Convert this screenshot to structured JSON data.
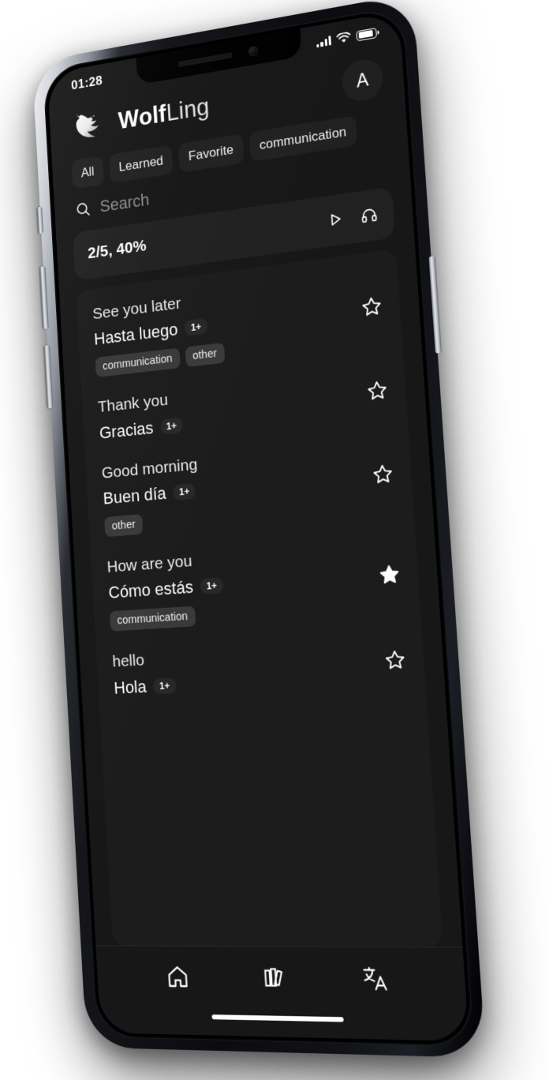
{
  "status_bar": {
    "time": "01:28",
    "cellular_icon": "cellular-bars-icon",
    "wifi_icon": "wifi-icon",
    "battery_icon": "battery-icon"
  },
  "header": {
    "logo_icon": "wolf-head-logo",
    "brand_bold": "Wolf",
    "brand_light": "Ling",
    "avatar_initial": "A"
  },
  "filters": {
    "chips": [
      {
        "label": "All"
      },
      {
        "label": "Learned"
      },
      {
        "label": "Favorite"
      },
      {
        "label": "communication"
      }
    ]
  },
  "search": {
    "icon": "search-icon",
    "placeholder": "Search",
    "value": ""
  },
  "progress": {
    "label": "2/5, 40%",
    "play_icon": "play-icon",
    "listen_icon": "headphones-icon"
  },
  "entries": [
    {
      "source": "See you later",
      "target": "Hasta luego",
      "count": "1+",
      "tags": [
        "communication",
        "other"
      ],
      "favorite": false
    },
    {
      "source": "Thank you",
      "target": "Gracias",
      "count": "1+",
      "tags": [],
      "favorite": false
    },
    {
      "source": "Good morning",
      "target": "Buen día",
      "count": "1+",
      "tags": [
        "other"
      ],
      "favorite": false
    },
    {
      "source": "How are you",
      "target": "Cómo estás",
      "count": "1+",
      "tags": [
        "communication"
      ],
      "favorite": true
    },
    {
      "source": "hello",
      "target": "Hola",
      "count": "1+",
      "tags": [],
      "favorite": false
    }
  ],
  "bottom_nav": [
    {
      "icon": "home-icon",
      "name": "home"
    },
    {
      "icon": "books-icon",
      "name": "library"
    },
    {
      "icon": "translate-icon",
      "name": "translate"
    }
  ],
  "colors": {
    "screen_bg": "#171717",
    "card_bg": "#1c1c1c",
    "chip_bg": "#212121",
    "tag_bg": "#3a3a3a",
    "text_primary": "#ffffff",
    "text_muted": "#8d8d8d"
  }
}
